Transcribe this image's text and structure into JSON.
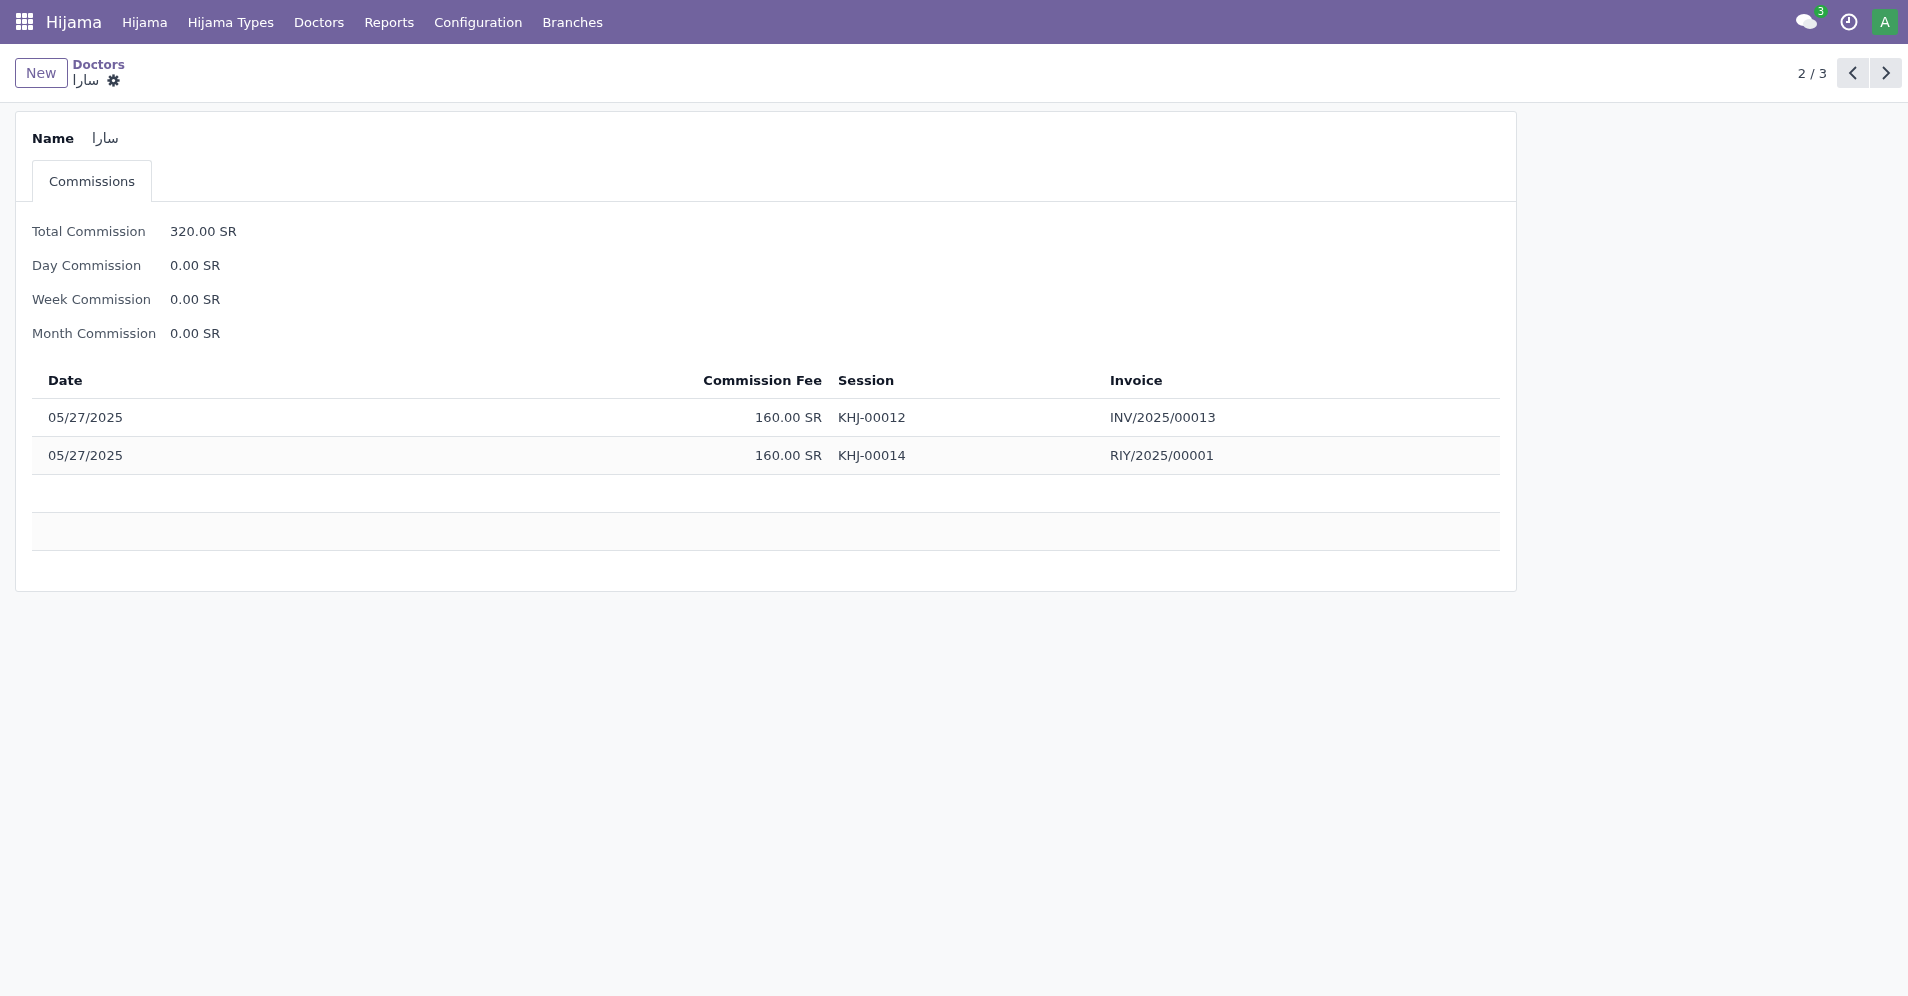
{
  "navbar": {
    "app_name": "Hijama",
    "menu": [
      "Hijama",
      "Hijama Types",
      "Doctors",
      "Reports",
      "Configuration",
      "Branches"
    ],
    "messages_count": "3",
    "avatar_letter": "A"
  },
  "control_panel": {
    "new_button": "New",
    "breadcrumb": "Doctors",
    "record_title": "سارا",
    "pager": "2 / 3"
  },
  "form": {
    "name_label": "Name",
    "name_value": "سارا",
    "tabs": [
      {
        "label": "Commissions",
        "selected": true
      }
    ],
    "fields": [
      {
        "label": "Total Commission",
        "value": "320.00 SR"
      },
      {
        "label": "Day Commission",
        "value": "0.00 SR"
      },
      {
        "label": "Week Commission",
        "value": "0.00 SR"
      },
      {
        "label": "Month Commission",
        "value": "0.00 SR"
      }
    ],
    "table": {
      "columns": [
        "Date",
        "Commission Fee",
        "Session",
        "Invoice"
      ],
      "rows": [
        [
          "05/27/2025",
          "160.00 SR",
          "KHJ-00012",
          "INV/2025/00013"
        ],
        [
          "05/27/2025",
          "160.00 SR",
          "KHJ-00014",
          "RIY/2025/00001"
        ]
      ]
    }
  }
}
